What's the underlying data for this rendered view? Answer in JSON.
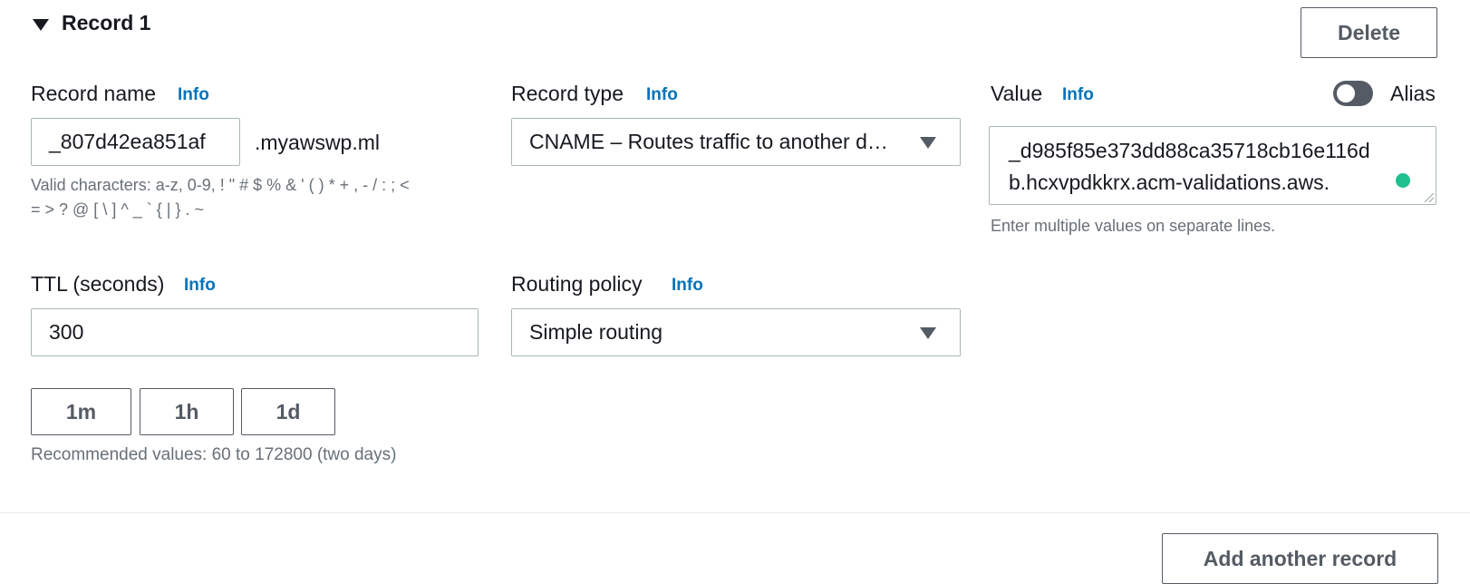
{
  "record": {
    "title": "Record 1",
    "delete_label": "Delete"
  },
  "record_name": {
    "label": "Record name",
    "info": "Info",
    "value": "_807d42ea851af",
    "domain_suffix": ".myawswp.ml",
    "hint_line1": "Valid characters: a-z, 0-9, ! \" # $ % & ' ( ) * + , - / : ; <",
    "hint_line2": "= > ? @ [ \\ ] ^ _ ` { | } . ~"
  },
  "record_type": {
    "label": "Record type",
    "info": "Info",
    "selected": "CNAME – Routes traffic to another d…"
  },
  "value_field": {
    "label": "Value",
    "info": "Info",
    "alias_label": "Alias",
    "alias_enabled": false,
    "line1": "_d985f85e373dd88ca35718cb16e116d",
    "line2": "b.hcxvpdkkrx.acm-validations.aws.",
    "hint": "Enter multiple values on separate lines."
  },
  "ttl": {
    "label": "TTL (seconds)",
    "info": "Info",
    "value": "300",
    "presets": [
      "1m",
      "1h",
      "1d"
    ],
    "hint": "Recommended values: 60 to 172800 (two days)"
  },
  "routing_policy": {
    "label": "Routing policy",
    "info": "Info",
    "selected": "Simple routing"
  },
  "footer": {
    "add_label": "Add another record"
  },
  "colors": {
    "link": "#0073bb",
    "status_dot": "#1fbf8f",
    "toggle_off": "#545b64"
  }
}
